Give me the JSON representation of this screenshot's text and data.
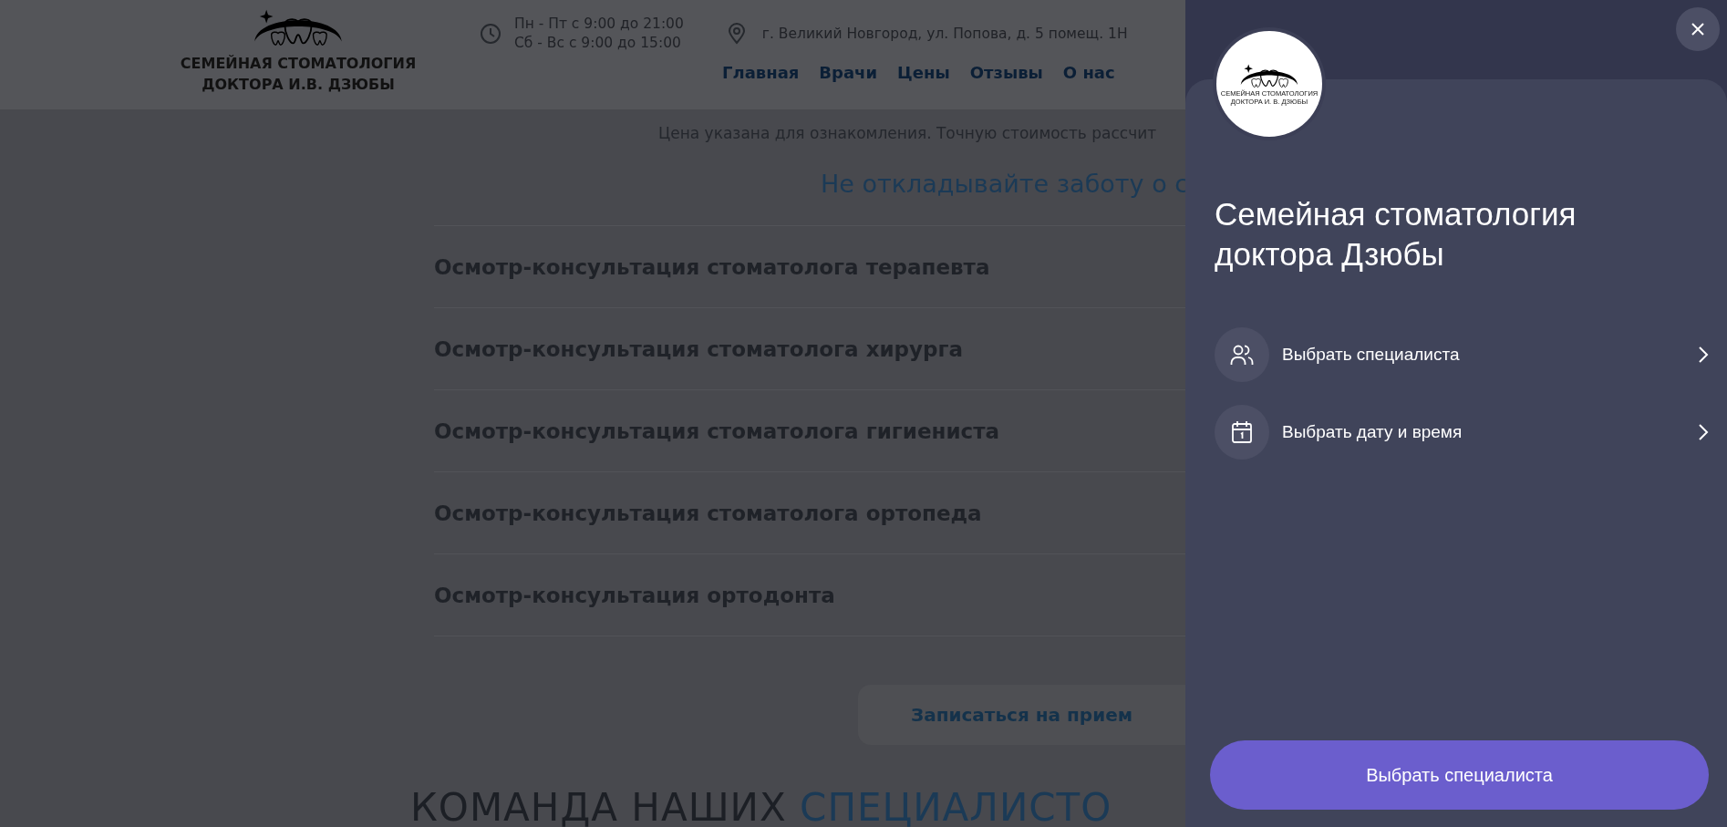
{
  "header": {
    "logo_lines": [
      "СЕМЕЙНАЯ СТОМАТОЛОГИЯ",
      "ДОКТОРА И.В. ДЗЮБЫ"
    ],
    "hours": [
      "Пн - Пт с 9:00 до 21:00",
      "Сб - Вс с 9:00 до 15:00"
    ],
    "address": "г. Великий Новгород, ул. Попова, д. 5 помещ. 1Н",
    "nav": [
      "Главная",
      "Врачи",
      "Цены",
      "Отзывы",
      "О нас"
    ]
  },
  "price_note": "Цена указана для ознакомления. Точную стоимость рассчит",
  "section_heading": "Не откладывайте заботу о с",
  "services": [
    "Осмотр-консультация стоматолога терапевта",
    "Осмотр-консультация стоматолога хирурга",
    "Осмотр-консультация стоматолога гигиениста",
    "Осмотр-консультация стоматолога ортопеда",
    "Осмотр-консультация ортодонта"
  ],
  "appointment_button": "Записаться на прием",
  "team_heading": {
    "text": "КОМАНДА НАШИХ",
    "accent": "СПЕЦИАЛИСТО"
  },
  "panel": {
    "logo_lines": [
      "СЕМЕЙНАЯ СТОМАТОЛОГИЯ",
      "ДОКТОРА И. В. ДЗЮБЫ"
    ],
    "title": "Семейная стоматология доктора Дзюбы",
    "options": [
      {
        "kind": "specialist",
        "label": "Выбрать специалиста"
      },
      {
        "kind": "datetime",
        "label": "Выбрать дату и время"
      }
    ],
    "primary_button": "Выбрать специалиста"
  }
}
